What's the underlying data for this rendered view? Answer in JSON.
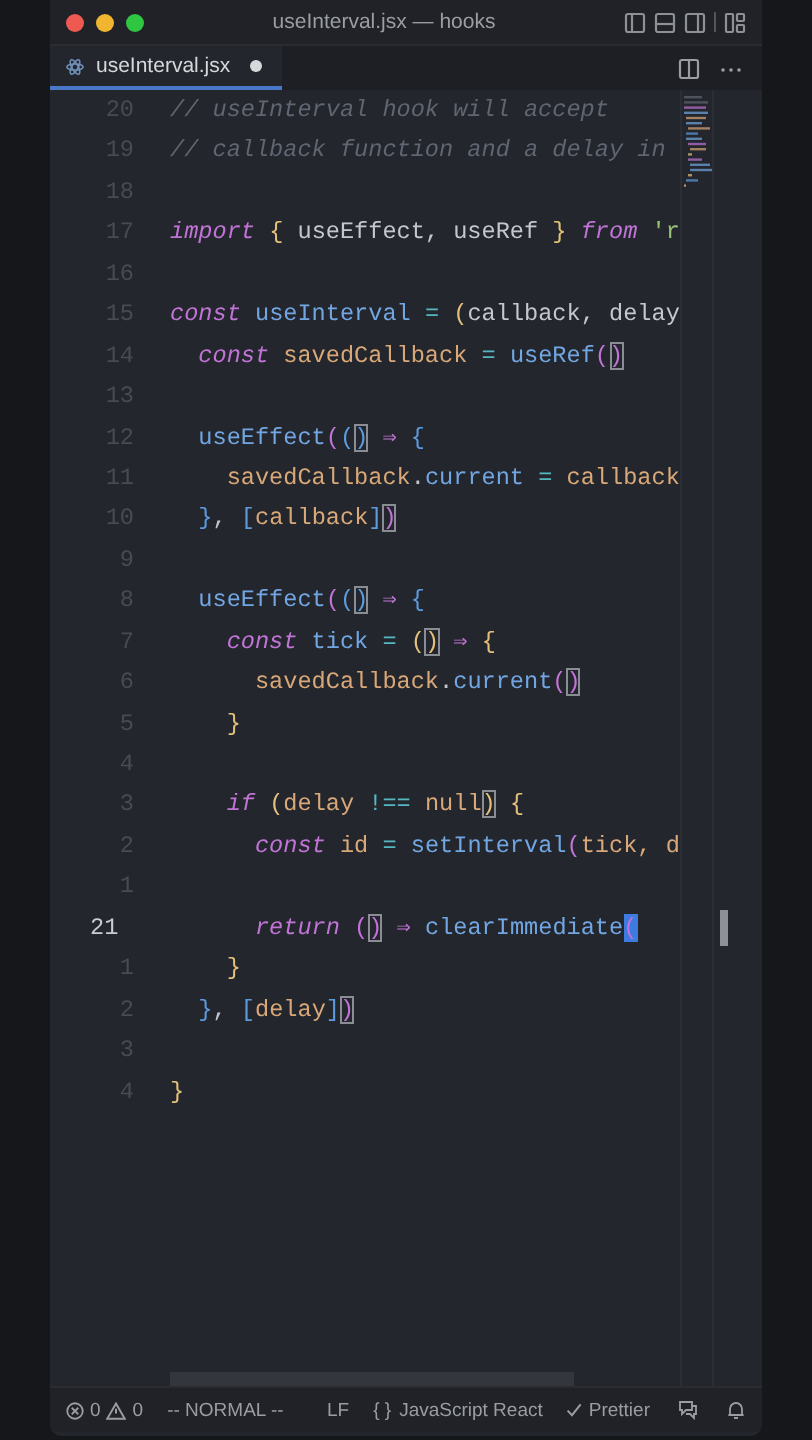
{
  "window": {
    "title": "useInterval.jsx — hooks"
  },
  "tabs": [
    {
      "label": "useInterval.jsx",
      "selected": true,
      "dirty": true
    }
  ],
  "editor": {
    "lines": [
      {
        "number": "20",
        "current": false,
        "tokens": [
          {
            "text": "// useInterval hook will accept",
            "kind": "comment"
          }
        ]
      },
      {
        "number": "19",
        "current": false,
        "tokens": [
          {
            "text": "// callback function and a delay in",
            "kind": "comment"
          }
        ]
      },
      {
        "number": "18",
        "current": false
      },
      {
        "number": "17",
        "current": false,
        "tokens": [
          {
            "text": "import ",
            "kind": "keyword"
          },
          {
            "text": "{",
            "kind": "brace"
          },
          {
            "text": " useEffect, useRef ",
            "kind": "plain"
          },
          {
            "text": "} ",
            "kind": "brace"
          },
          {
            "text": "from",
            "kind": "keyword"
          },
          {
            "text": " 'r",
            "kind": "string"
          }
        ]
      },
      {
        "number": "16",
        "current": false
      },
      {
        "number": "15",
        "current": false,
        "tokens": [
          {
            "text": "const",
            "kind": "keyword"
          },
          {
            "text": " useInterval",
            "kind": "function"
          },
          {
            "text": " = ",
            "kind": "operator"
          },
          {
            "text": "(",
            "kind": "brace"
          },
          {
            "text": "callback, delay",
            "kind": "plain"
          }
        ]
      },
      {
        "number": "14",
        "current": false,
        "tokens": [
          {
            "text": "  const",
            "kind": "keyword"
          },
          {
            "text": " savedCallback",
            "kind": "variable"
          },
          {
            "text": " = ",
            "kind": "operator"
          },
          {
            "text": "useRef",
            "kind": "function"
          },
          {
            "text": "(",
            "kind": "paren"
          },
          {
            "text": ")",
            "kind": "paren",
            "boxed": true
          }
        ]
      },
      {
        "number": "13",
        "current": false
      },
      {
        "number": "12",
        "current": false,
        "tokens": [
          {
            "text": "  useEffect",
            "kind": "function"
          },
          {
            "text": "(",
            "kind": "paren"
          },
          {
            "text": "(",
            "kind": "bracket"
          },
          {
            "text": ")",
            "kind": "bracket",
            "boxed": true
          },
          {
            "text": " ⇒ ",
            "kind": "arrow"
          },
          {
            "text": "{",
            "kind": "bracket"
          }
        ]
      },
      {
        "number": "11",
        "current": false,
        "tokens": [
          {
            "text": "    savedCallback",
            "kind": "variable"
          },
          {
            "text": ".",
            "kind": "plain"
          },
          {
            "text": "current",
            "kind": "function"
          },
          {
            "text": " = ",
            "kind": "operator"
          },
          {
            "text": "callback",
            "kind": "variable"
          }
        ]
      },
      {
        "number": "10",
        "current": false,
        "tokens": [
          {
            "text": "  }",
            "kind": "bracket"
          },
          {
            "text": ", ",
            "kind": "plain"
          },
          {
            "text": "[",
            "kind": "bracket"
          },
          {
            "text": "callback",
            "kind": "variable"
          },
          {
            "text": "]",
            "kind": "bracket"
          },
          {
            "text": ")",
            "kind": "paren",
            "boxed": true
          }
        ]
      },
      {
        "number": "9",
        "current": false
      },
      {
        "number": "8",
        "current": false,
        "tokens": [
          {
            "text": "  useEffect",
            "kind": "function"
          },
          {
            "text": "(",
            "kind": "paren"
          },
          {
            "text": "(",
            "kind": "bracket"
          },
          {
            "text": ")",
            "kind": "bracket",
            "boxed": true
          },
          {
            "text": " ⇒ ",
            "kind": "arrow"
          },
          {
            "text": "{",
            "kind": "bracket"
          }
        ]
      },
      {
        "number": "7",
        "current": false,
        "tokens": [
          {
            "text": "    const",
            "kind": "keyword"
          },
          {
            "text": " tick",
            "kind": "function"
          },
          {
            "text": " = ",
            "kind": "operator"
          },
          {
            "text": "(",
            "kind": "brace"
          },
          {
            "text": ")",
            "kind": "brace",
            "boxed": true
          },
          {
            "text": " ⇒ ",
            "kind": "arrow"
          },
          {
            "text": "{",
            "kind": "brace"
          }
        ]
      },
      {
        "number": "6",
        "current": false,
        "tokens": [
          {
            "text": "      savedCallback",
            "kind": "variable"
          },
          {
            "text": ".",
            "kind": "plain"
          },
          {
            "text": "current",
            "kind": "function"
          },
          {
            "text": "(",
            "kind": "paren"
          },
          {
            "text": ")",
            "kind": "paren",
            "boxed": true
          }
        ]
      },
      {
        "number": "5",
        "current": false,
        "tokens": [
          {
            "text": "    }",
            "kind": "brace"
          }
        ]
      },
      {
        "number": "4",
        "current": false
      },
      {
        "number": "3",
        "current": false,
        "tokens": [
          {
            "text": "    if ",
            "kind": "keyword"
          },
          {
            "text": "(",
            "kind": "brace"
          },
          {
            "text": "delay",
            "kind": "variable"
          },
          {
            "text": " !== ",
            "kind": "operator"
          },
          {
            "text": "null",
            "kind": "variable"
          },
          {
            "text": ")",
            "kind": "brace",
            "boxed": true
          },
          {
            "text": " {",
            "kind": "brace"
          }
        ]
      },
      {
        "number": "2",
        "current": false,
        "tokens": [
          {
            "text": "      const",
            "kind": "keyword"
          },
          {
            "text": " id",
            "kind": "variable"
          },
          {
            "text": " = ",
            "kind": "operator"
          },
          {
            "text": "setInterval",
            "kind": "function"
          },
          {
            "text": "(",
            "kind": "paren"
          },
          {
            "text": "tick, d",
            "kind": "variable"
          }
        ]
      },
      {
        "number": "1",
        "current": false
      },
      {
        "number": "21",
        "current": true,
        "tokens": [
          {
            "text": "      return ",
            "kind": "keyword"
          },
          {
            "text": "(",
            "kind": "paren"
          },
          {
            "text": ")",
            "kind": "paren",
            "boxed": true
          },
          {
            "text": " ⇒ ",
            "kind": "arrow"
          },
          {
            "text": "clearImmediate",
            "kind": "function"
          },
          {
            "text": "(",
            "kind": "cursor"
          }
        ]
      },
      {
        "number": "1",
        "current": false,
        "tokens": [
          {
            "text": "    }",
            "kind": "brace"
          }
        ]
      },
      {
        "number": "2",
        "current": false,
        "tokens": [
          {
            "text": "  }",
            "kind": "bracket"
          },
          {
            "text": ", ",
            "kind": "plain"
          },
          {
            "text": "[",
            "kind": "bracket"
          },
          {
            "text": "delay",
            "kind": "variable"
          },
          {
            "text": "]",
            "kind": "bracket"
          },
          {
            "text": ")",
            "kind": "paren",
            "boxed": true
          }
        ]
      },
      {
        "number": "3",
        "current": false
      },
      {
        "number": "4",
        "current": false,
        "tokens": [
          {
            "text": "}",
            "kind": "brace"
          }
        ]
      }
    ]
  },
  "status_bar": {
    "errors": "0",
    "warnings": "0",
    "mode": "-- NORMAL --",
    "line_ending": "LF",
    "language_icon": "{ }",
    "language": "JavaScript React",
    "formatter": "Prettier"
  }
}
